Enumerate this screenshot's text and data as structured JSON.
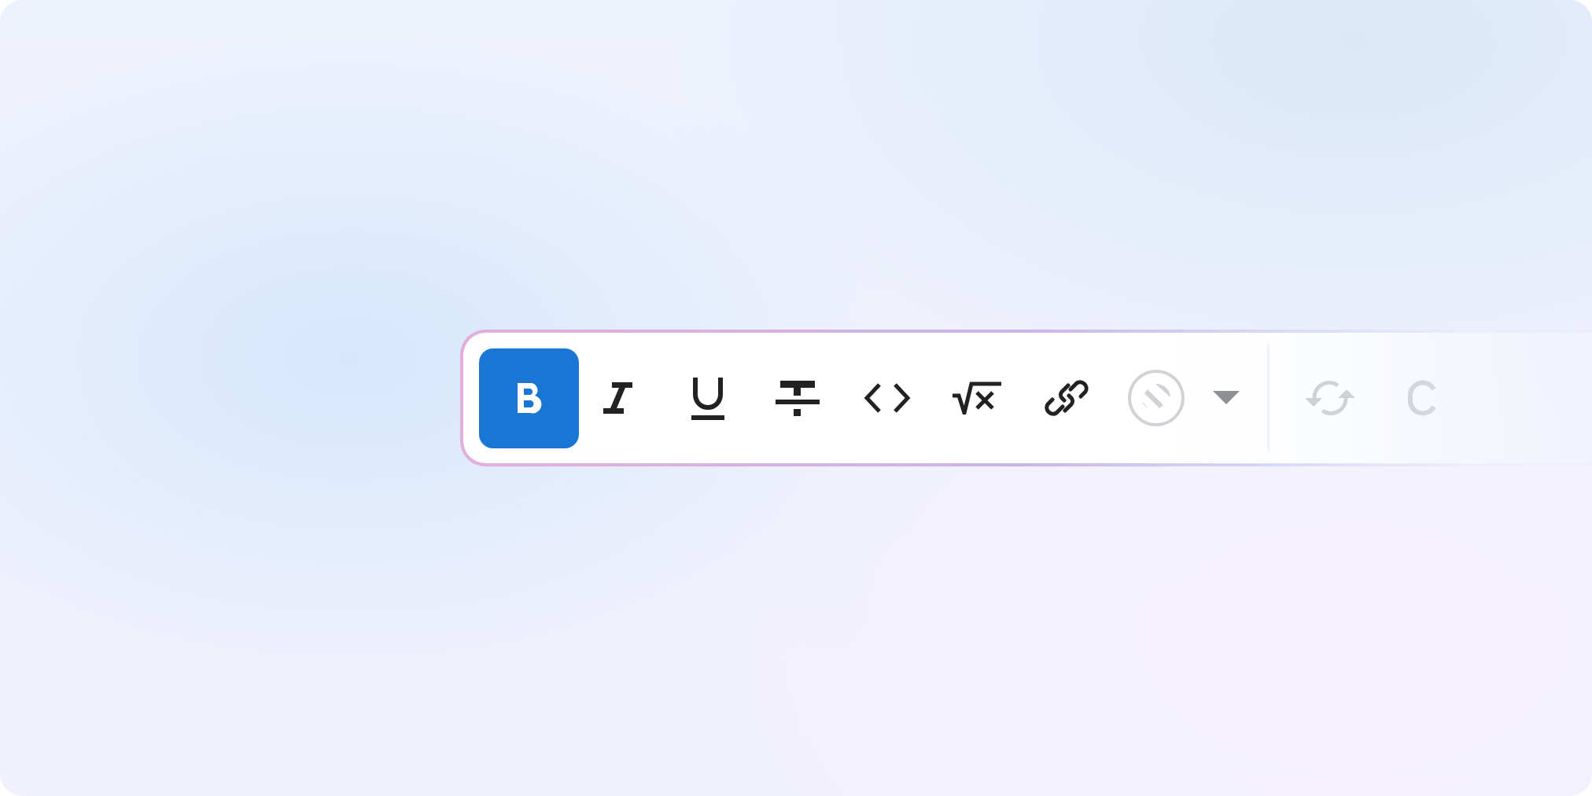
{
  "toolbar": {
    "tools": [
      {
        "kind": "bold",
        "selected": true,
        "disabled": false
      },
      {
        "kind": "italic",
        "selected": false,
        "disabled": false
      },
      {
        "kind": "underline",
        "selected": false,
        "disabled": false
      },
      {
        "kind": "strikethrough",
        "selected": false,
        "disabled": false
      },
      {
        "kind": "code",
        "selected": false,
        "disabled": false
      },
      {
        "kind": "formula",
        "selected": false,
        "disabled": false
      },
      {
        "kind": "link",
        "selected": false,
        "disabled": false
      },
      {
        "kind": "highlight",
        "selected": false,
        "disabled": true
      },
      {
        "kind": "dropdown",
        "selected": false,
        "disabled": false
      },
      {
        "kind": "divider"
      },
      {
        "kind": "sync",
        "selected": false,
        "disabled": true
      },
      {
        "kind": "partial",
        "selected": false,
        "disabled": true
      }
    ]
  }
}
